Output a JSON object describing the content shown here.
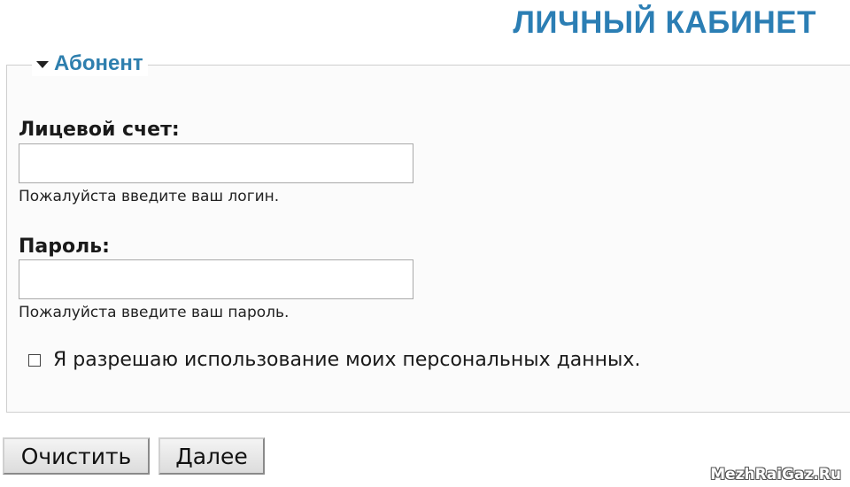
{
  "header": {
    "title": "ЛИЧНЫЙ КАБИНЕТ"
  },
  "fieldset": {
    "legend": "Абонент",
    "account": {
      "label": "Лицевой счет:",
      "value": "",
      "hint": "Пожалуйста введите ваш логин."
    },
    "password": {
      "label": "Пароль:",
      "value": "",
      "hint": "Пожалуйста введите ваш пароль."
    },
    "consent": {
      "label": "Я разрешаю использование моих персональных данных.",
      "checked": false
    }
  },
  "buttons": {
    "clear_label": "Очистить",
    "next_label": "Далее"
  },
  "watermark": "MezhRaiGaz.Ru",
  "colors": {
    "title": "#2b7eb4",
    "legend": "#2e7fae"
  },
  "icons": {
    "legend_toggle": "triangle-down-icon"
  }
}
